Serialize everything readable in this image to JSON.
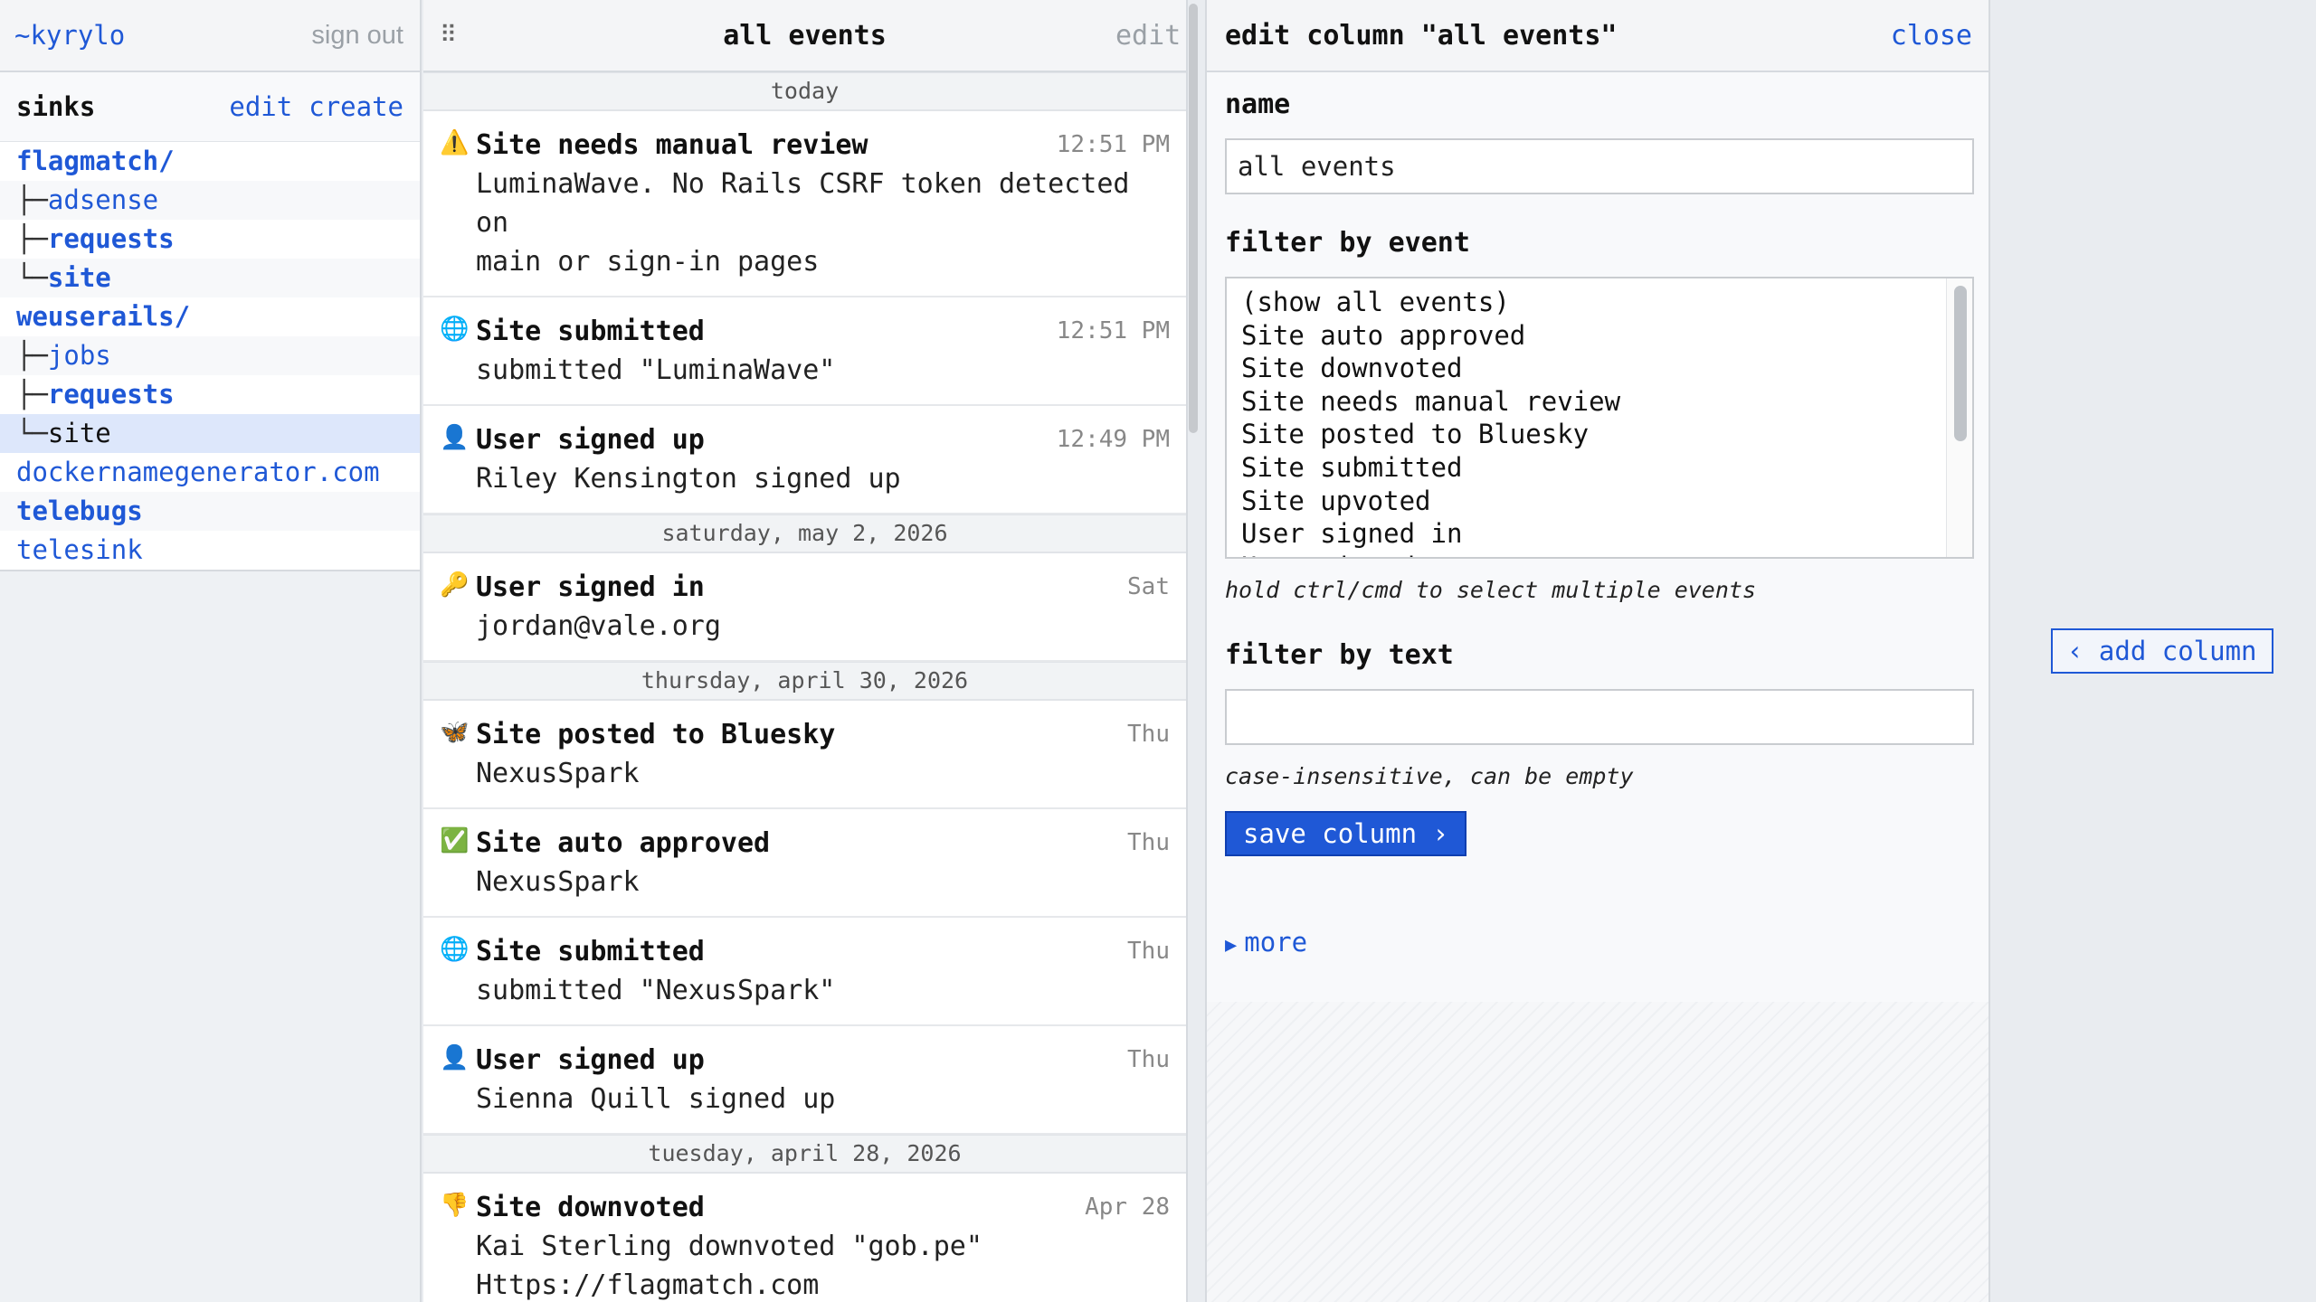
{
  "sidebar": {
    "user": "~kyrylo",
    "sign_out": "sign out",
    "sinks_title": "sinks",
    "edit": "edit",
    "create": "create",
    "items": [
      {
        "prefix": "",
        "label": "flagmatch/"
      },
      {
        "prefix": "├─",
        "label": "adsense"
      },
      {
        "prefix": "├─",
        "label": "requests"
      },
      {
        "prefix": "└─",
        "label": "site"
      },
      {
        "prefix": "",
        "label": "weuserails/"
      },
      {
        "prefix": "├─",
        "label": "jobs"
      },
      {
        "prefix": "├─",
        "label": "requests"
      },
      {
        "prefix": "└─",
        "label": "site"
      },
      {
        "prefix": "",
        "label": "dockernamegenerator.com"
      },
      {
        "prefix": "",
        "label": "telebugs"
      },
      {
        "prefix": "",
        "label": "telesink"
      }
    ]
  },
  "events": {
    "title": "all events",
    "edit": "edit",
    "grip": "⠿",
    "groups": [
      {
        "day": "today",
        "items": [
          {
            "icon": "⚠️",
            "title": "Site needs manual review",
            "time": "12:51 PM",
            "desc": [
              "LuminaWave. No Rails CSRF token detected on",
              "main or sign-in pages"
            ]
          },
          {
            "icon": "🌐",
            "title": "Site submitted",
            "time": "12:51 PM",
            "desc": [
              "submitted \"LuminaWave\""
            ]
          },
          {
            "icon": "👤",
            "title": "User signed up",
            "time": "12:49 PM",
            "desc": [
              "Riley Kensington signed up"
            ]
          }
        ]
      },
      {
        "day": "saturday, may 2, 2026",
        "items": [
          {
            "icon": "🔑",
            "title": "User signed in",
            "time": "Sat",
            "desc": [
              "jordan@vale.org"
            ]
          }
        ]
      },
      {
        "day": "thursday, april 30, 2026",
        "items": [
          {
            "icon": "🦋",
            "title": "Site posted to Bluesky",
            "time": "Thu",
            "desc": [
              "NexusSpark"
            ]
          },
          {
            "icon": "✅",
            "title": "Site auto approved",
            "time": "Thu",
            "desc": [
              "NexusSpark"
            ]
          },
          {
            "icon": "🌐",
            "title": "Site submitted",
            "time": "Thu",
            "desc": [
              "submitted \"NexusSpark\""
            ]
          },
          {
            "icon": "👤",
            "title": "User signed up",
            "time": "Thu",
            "desc": [
              "Sienna Quill signed up"
            ]
          }
        ]
      },
      {
        "day": "tuesday, april 28, 2026",
        "items": [
          {
            "icon": "👎",
            "title": "Site downvoted",
            "time": "Apr 28",
            "desc": [
              "Kai Sterling downvoted \"gob.pe\"",
              "Https://flagmatch.com"
            ]
          }
        ]
      }
    ]
  },
  "edit_panel": {
    "title": "edit column \"all events\"",
    "close": "close",
    "name_label": "name",
    "name_value": "all events",
    "filter_event_label": "filter by event",
    "event_options": [
      "(show all events)",
      "Site auto approved",
      "Site downvoted",
      "Site needs manual review",
      "Site posted to Bluesky",
      "Site submitted",
      "Site upvoted",
      "User signed in",
      "User signed up"
    ],
    "event_hint": "hold ctrl/cmd to select multiple events",
    "filter_text_label": "filter by text",
    "filter_text_value": "",
    "text_hint": "case-insensitive, can be empty",
    "save_label": "save column ›",
    "more_label": "more"
  },
  "add_column": "‹ add column",
  "colors": {
    "accent": "#1f58d6",
    "muted": "#9aa0a6"
  }
}
